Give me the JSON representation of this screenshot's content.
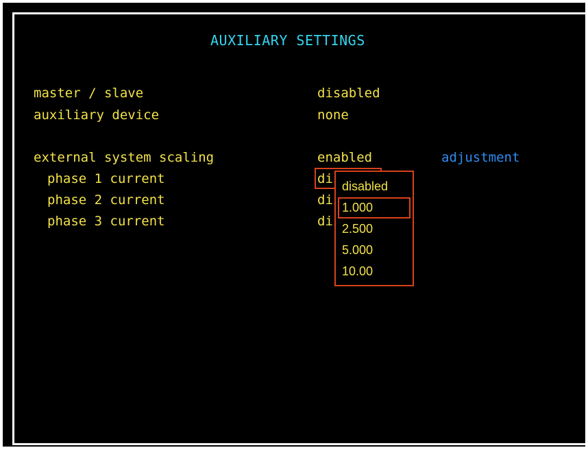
{
  "screen": {
    "title": "AUXILIARY SETTINGS"
  },
  "settings": [
    {
      "label": "master / slave",
      "value": "disabled"
    },
    {
      "label": "auxiliary device",
      "value": "none"
    },
    {
      "label": "external system scaling",
      "value": "enabled",
      "action": "adjustment"
    },
    {
      "label": "phase 1 current",
      "value_visible": "dis"
    },
    {
      "label": "phase 2 current",
      "value_visible": "dis"
    },
    {
      "label": "phase 3 current",
      "value_visible": "dis"
    }
  ],
  "dropdown": {
    "options": [
      "disabled",
      "1.000",
      "2.500",
      "5.000",
      "10.00"
    ],
    "highlighted": "1.000"
  },
  "colors": {
    "label": "#f2e24a",
    "title": "#35d5f0",
    "action": "#2f8df0",
    "selection": "#d8421c",
    "background": "#000000"
  }
}
